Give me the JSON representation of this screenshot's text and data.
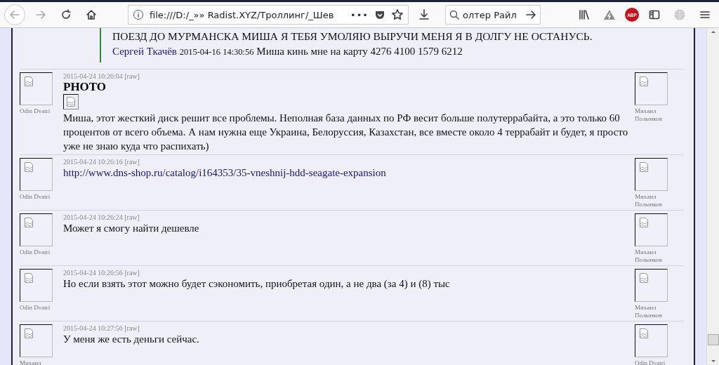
{
  "toolbar": {
    "url": "file:///D:/_»» Radist.XYZ/Троллинг/_Шев",
    "page_actions": "•••",
    "search_value": "олтер Райл",
    "adblock_label": "ABP"
  },
  "quote": {
    "text": "ПОЕЗД ДО МУРМАНСКА МИША Я ТЕБЯ УМОЛЯЮ ВЫРУЧИ МЕНЯ Я В ДОЛГУ НЕ ОСТАНУСЬ.",
    "author": "Сергей Ткачёв",
    "time": "2015-04-16 14:30:56",
    "message": "Миша кинь мне на карту 4276 4100 1579 6212"
  },
  "messages": [
    {
      "kind": "photo",
      "time": "2015-04-24 10:26:04",
      "raw": "[raw]",
      "title": "PHOTO",
      "text": "Миша, этот жесткий диск решит все проблемы. Неполная база данных по РФ весит больше полутеррабайта, а это только 60 процентов от всего объема. А нам нужна еще Украина, Белоруссия, Казахстан, все вместе около 4 террабайт и будет, я просто уже не знаю куда что распихать)",
      "left_name": "Odin Dvatri",
      "right_name": "Михаил Полынков"
    },
    {
      "kind": "link",
      "time": "2015-04-24 10:26:16",
      "raw": "[raw]",
      "text": "http://www.dns-shop.ru/catalog/i164353/35-vneshnij-hdd-seagate-expansion",
      "left_name": "Odin Dvatri",
      "right_name": "Михаил Полынков"
    },
    {
      "kind": "text",
      "time": "2015-04-24 10:26:24",
      "raw": "[raw]",
      "text": "Может я смогу найти дешевле",
      "left_name": "Odin Dvatri",
      "right_name": "Михаил Полынков"
    },
    {
      "kind": "text",
      "time": "2015-04-24 10:26:56",
      "raw": "[raw]",
      "text": "Но если взять этот можно будет сэкономить, приобретая один, а не два (за 4) и (8) тыс",
      "left_name": "Odin Dvatri",
      "right_name": "Михаил Полынков"
    },
    {
      "kind": "text",
      "time": "2015-04-24 10:27:56",
      "raw": "[raw]",
      "text": "У меня же есть деньги сейчас.",
      "left_name": "Михаил",
      "right_name": "Odin Dvatri"
    }
  ]
}
